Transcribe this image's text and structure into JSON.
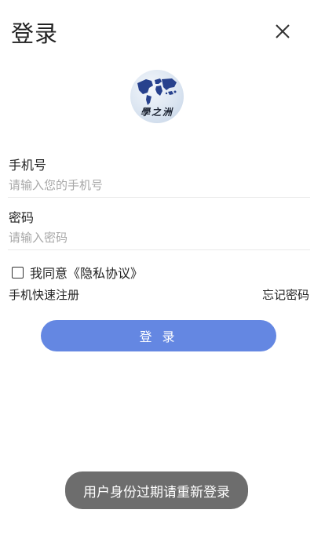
{
  "header": {
    "title": "登录",
    "close_icon": "close-icon"
  },
  "logo": {
    "text": "學之洲"
  },
  "form": {
    "phone": {
      "label": "手机号",
      "placeholder": "请输入您的手机号",
      "value": ""
    },
    "password": {
      "label": "密码",
      "placeholder": "请输入密码",
      "value": ""
    },
    "agreement": {
      "text": "我同意《隐私协议》",
      "checked": false
    }
  },
  "links": {
    "register": "手机快速注册",
    "forgot": "忘记密码"
  },
  "actions": {
    "login_label": "登 录"
  },
  "toast": {
    "message": "用户身份过期请重新登录"
  },
  "colors": {
    "primary": "#6487e2",
    "toast_bg": "#6d6d6d",
    "text": "#222222",
    "placeholder": "#a8a8a8"
  }
}
